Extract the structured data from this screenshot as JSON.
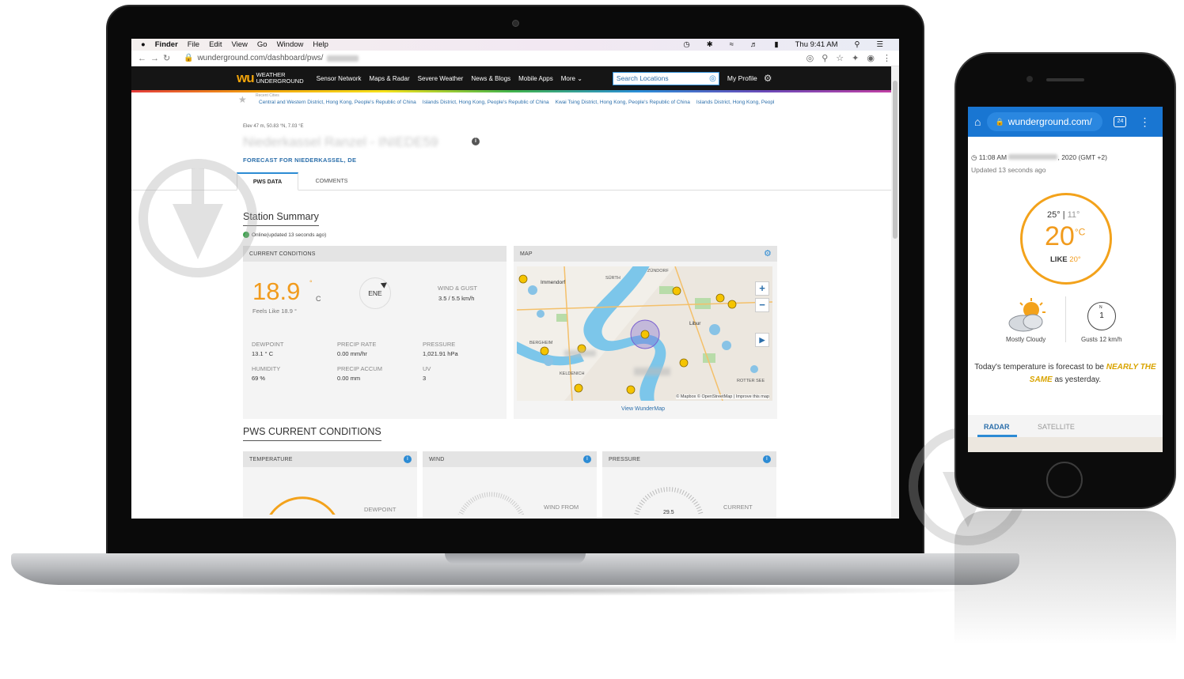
{
  "menubar": {
    "apple": "",
    "app": "Finder",
    "items": [
      "File",
      "Edit",
      "View",
      "Go",
      "Window",
      "Help"
    ],
    "clock": "Thu 9:41 AM"
  },
  "browser": {
    "url": "wunderground.com/dashboard/pws/"
  },
  "wu": {
    "logo_mark": "wu",
    "logo_line1": "WEATHER",
    "logo_line2": "UNDERGROUND",
    "nav": [
      "Sensor Network",
      "Maps & Radar",
      "Severe Weather",
      "News & Blogs",
      "Mobile Apps",
      "More"
    ],
    "search_placeholder": "Search Locations",
    "profile": "My Profile",
    "recent_label": "Recent Cities",
    "recent_cities": [
      "Central and Western District, Hong Kong, People's Republic of China",
      "Islands District, Hong Kong, People's Republic of China",
      "Kwai Tsing District, Hong Kong, People's Republic of China",
      "Islands District, Hong Kong, Peopl"
    ]
  },
  "station": {
    "meta": "Elev 47 m, 50.83 °N, 7.03 °E",
    "name": "Niederkassel Ranzel - INIEDE59",
    "forecast_link": "FORECAST FOR NIEDERKASSEL, DE",
    "tabs": [
      "PWS DATA",
      "COMMENTS"
    ],
    "summary_title": "Station Summary",
    "online_text": "Online(updated 13 seconds ago)"
  },
  "current": {
    "header": "CURRENT CONDITIONS",
    "temp": "18.9",
    "temp_deg": "°",
    "temp_unit": "C",
    "feels_like": "Feels Like 18.9 °",
    "wind_dir": "ENE",
    "wind_label": "WIND & GUST",
    "wind_value": "3.5  / 5.5 km/h",
    "dewpoint_label": "DEWPOINT",
    "dewpoint_value": "13.1 ° C",
    "precip_rate_label": "PRECIP RATE",
    "precip_rate_value": "0.00  mm/hr",
    "pressure_label": "PRESSURE",
    "pressure_value": "1,021.91  hPa",
    "humidity_label": "HUMIDITY",
    "humidity_value": "69  %",
    "precip_accum_label": "PRECIP ACCUM",
    "precip_accum_value": "0.00  mm",
    "uv_label": "UV",
    "uv_value": "3"
  },
  "map": {
    "header": "MAP",
    "link": "View WunderMap",
    "credit": "© Mapbox © OpenStreetMap | Improve this map",
    "places": [
      "Immendorf",
      "ZÜNDORF",
      "SÜRTH",
      "Libur",
      "KELDENICH",
      "BERGHEIM",
      "ROTTER SEE"
    ],
    "road_labels": [
      "L300",
      "555",
      "L269",
      "L84"
    ],
    "markers": [
      "19",
      "21",
      "21",
      "21",
      "19",
      "20",
      "22",
      "21",
      "19"
    ]
  },
  "pws": {
    "title": "PWS CURRENT CONDITIONS",
    "temperature_header": "TEMPERATURE",
    "wind_header": "WIND",
    "pressure_header": "PRESSURE",
    "dewpoint_label": "DEWPOINT",
    "wind_from_label": "WIND FROM",
    "current_label": "CURRENT",
    "pressure_gauge_value": "29.5"
  },
  "phone": {
    "url": "wunderground.com/",
    "tab_count": "24",
    "time": "11:08 AM",
    "time_suffix": ", 2020 (GMT +2)",
    "updated": "Updated 13 seconds ago",
    "hi": "25°",
    "lo": "11°",
    "temp": "20",
    "temp_unit": "°C",
    "like_label": "LIKE",
    "like_value": "20°",
    "condition": "Mostly Cloudy",
    "gust_dir": "N",
    "gust_value": "1",
    "gusts": "Gusts 12 km/h",
    "forecast_a": "Today's temperature is forecast to be ",
    "forecast_em": "NEARLY THE SAME",
    "forecast_b": " as yesterday.",
    "tab_radar": "RADAR",
    "tab_satellite": "SATELLITE"
  },
  "colors": {
    "accent_blue": "#2c8bd4",
    "temp_orange": "#f19b1d",
    "online_green": "#3aa34b",
    "header_dark": "#151515",
    "mobile_bar": "#1976d2"
  }
}
